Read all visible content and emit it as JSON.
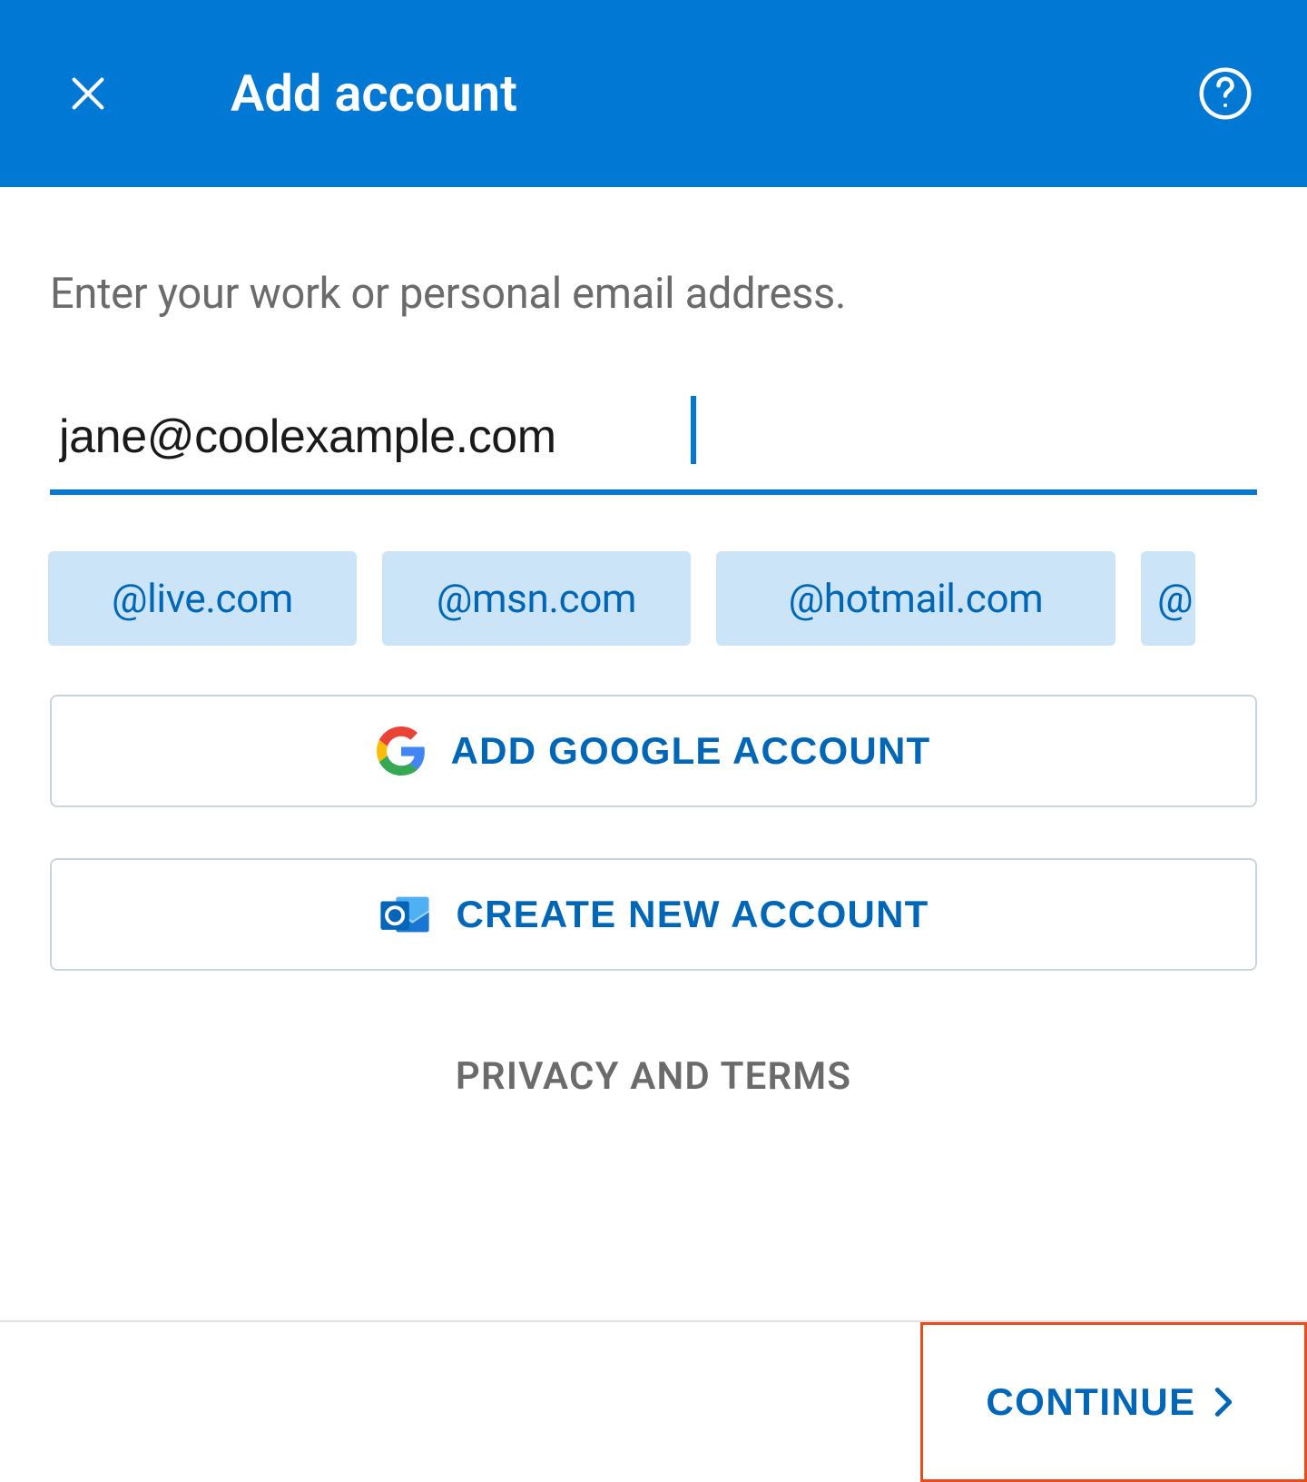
{
  "header": {
    "title": "Add account"
  },
  "main": {
    "prompt": "Enter your work or personal email address.",
    "email_value": "jane@coolexample.com",
    "domains": [
      "@live.com",
      "@msn.com",
      "@hotmail.com",
      "@"
    ],
    "google_button": "ADD GOOGLE ACCOUNT",
    "outlook_button": "CREATE NEW ACCOUNT",
    "privacy_link": "PRIVACY AND TERMS"
  },
  "footer": {
    "continue_label": "CONTINUE"
  },
  "colors": {
    "primary": "#0078D4",
    "accent": "#0067B8",
    "highlight": "#E74C1E",
    "chip_bg": "#CCE4F7"
  }
}
